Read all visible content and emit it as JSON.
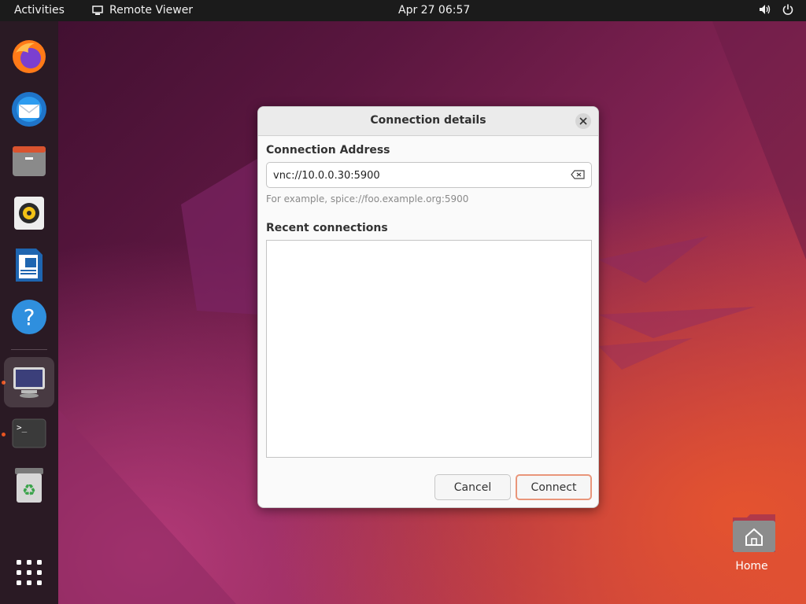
{
  "topbar": {
    "activities": "Activities",
    "app_name": "Remote Viewer",
    "clock": "Apr 27  06:57",
    "icons": [
      "speaker-icon",
      "power-icon"
    ]
  },
  "dock": {
    "items": [
      {
        "name": "Firefox",
        "icon": "firefox-icon"
      },
      {
        "name": "Thunderbird",
        "icon": "thunderbird-icon"
      },
      {
        "name": "Files",
        "icon": "files-icon"
      },
      {
        "name": "Rhythmbox",
        "icon": "rhythmbox-icon"
      },
      {
        "name": "LibreOffice Writer",
        "icon": "writer-icon"
      },
      {
        "name": "Help",
        "icon": "help-icon"
      },
      {
        "name": "Remote Viewer",
        "icon": "remote-viewer-icon",
        "active": true,
        "running": true
      },
      {
        "name": "Terminal",
        "icon": "terminal-icon",
        "running": true
      },
      {
        "name": "Trash",
        "icon": "trash-icon"
      },
      {
        "name": "Show Applications",
        "icon": "app-grid-icon"
      }
    ]
  },
  "desktop": {
    "home_label": "Home"
  },
  "dialog": {
    "title": "Connection details",
    "address_label": "Connection Address",
    "address_value": "vnc://10.0.0.30:5900",
    "hint": "For example, spice://foo.example.org:5900",
    "recent_label": "Recent connections",
    "recent_items": [],
    "cancel_label": "Cancel",
    "connect_label": "Connect"
  },
  "colors": {
    "accent": "#e95420",
    "topbar": "#1b1b1b",
    "dock": "#2a1a24"
  }
}
